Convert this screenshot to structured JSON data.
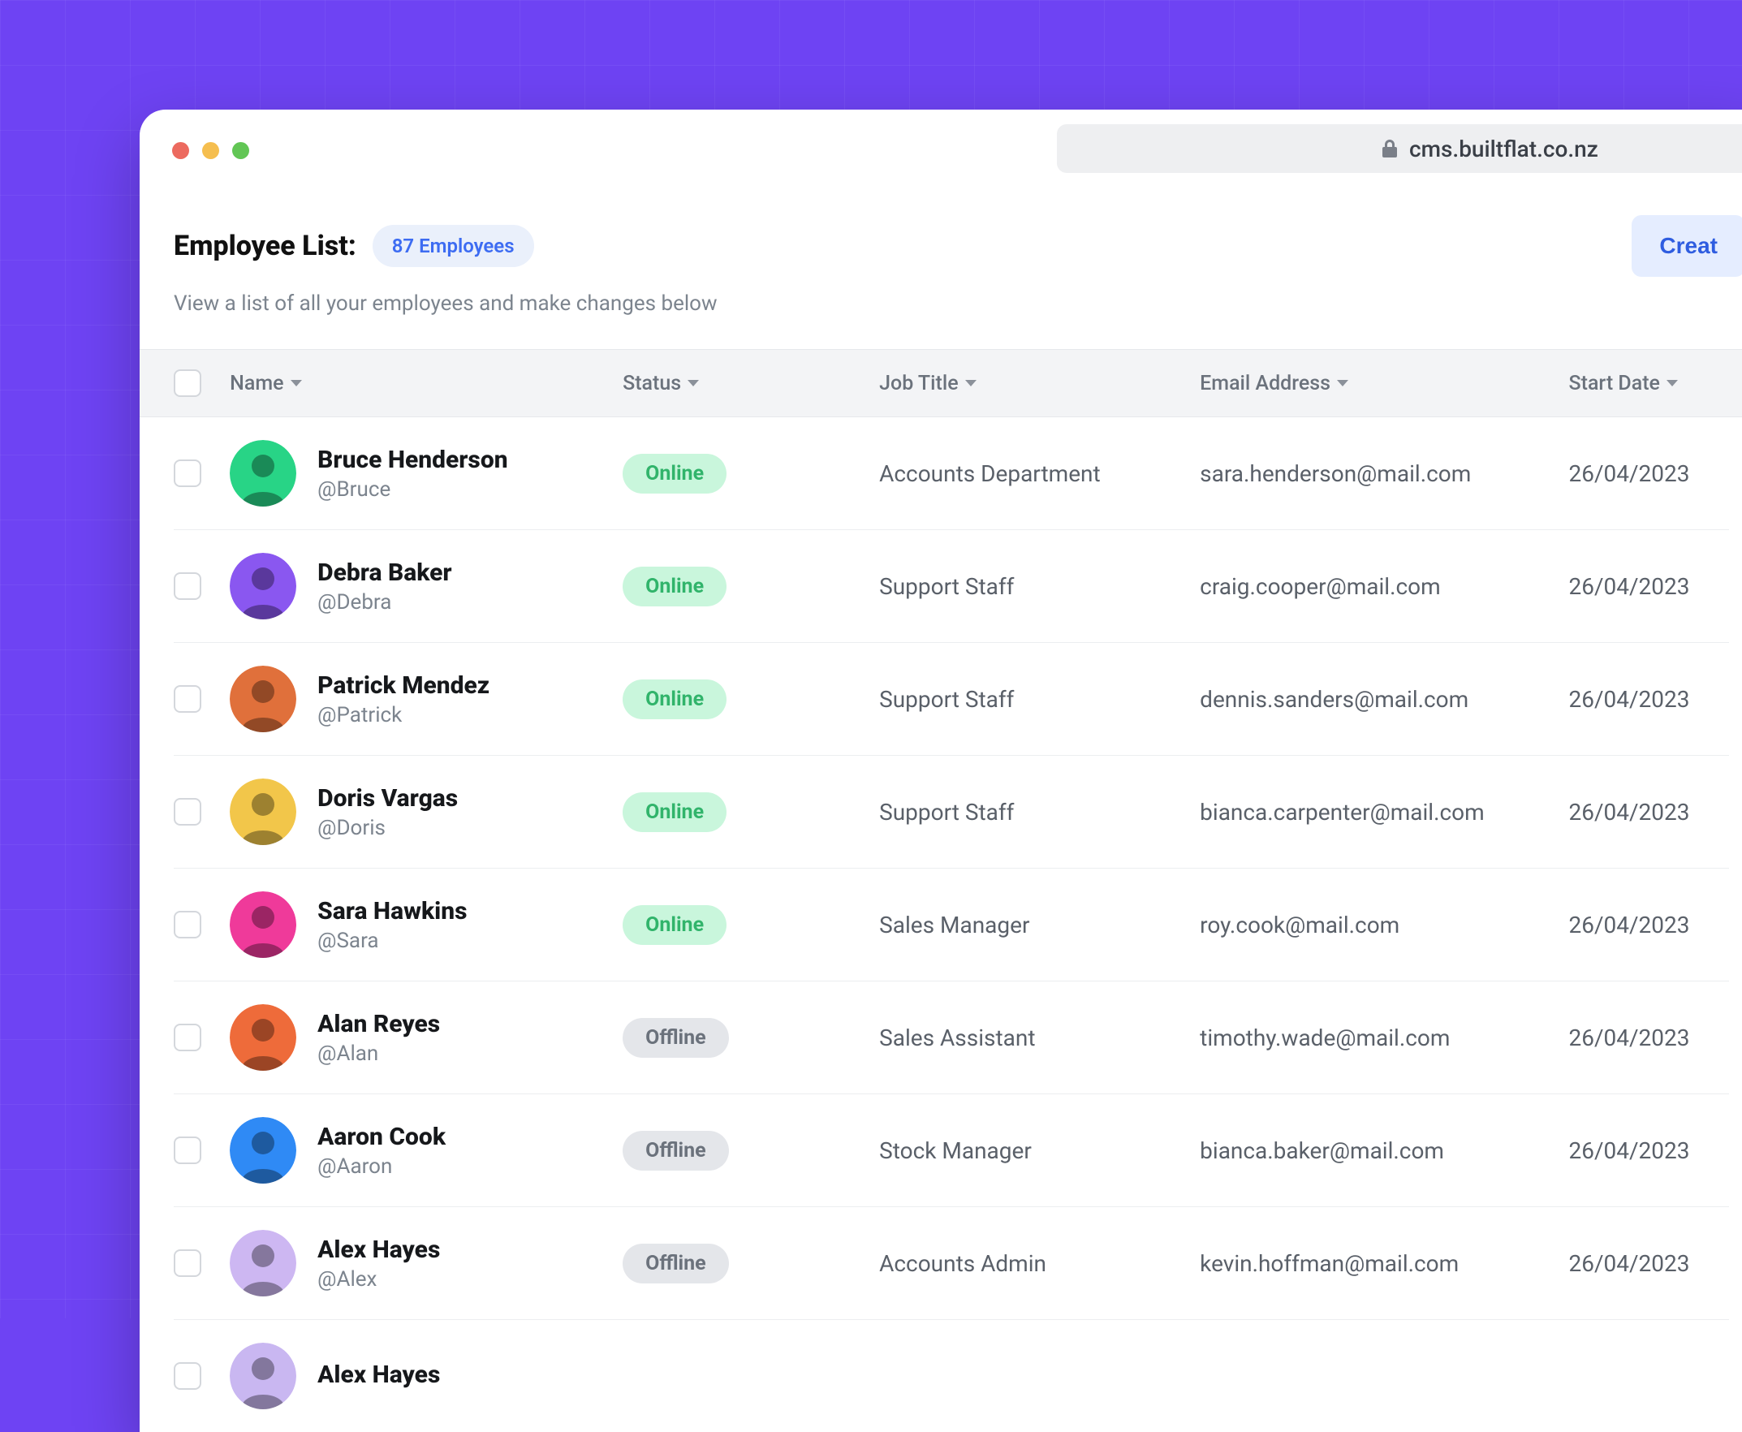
{
  "url": "cms.builtflat.co.nz",
  "header": {
    "title": "Employee List:",
    "count_badge": "87 Employees",
    "subtitle": "View a list of all your employees and make changes below",
    "create_button": "Creat"
  },
  "columns": {
    "name": "Name",
    "status": "Status",
    "job": "Job Title",
    "email": "Email Address",
    "start": "Start Date"
  },
  "status_labels": {
    "online": "Online",
    "offline": "Offline"
  },
  "avatar_colors": [
    "#28d486",
    "#8a57f0",
    "#e0703b",
    "#f2c64a",
    "#ef3a9a",
    "#ee6b3a",
    "#2f8af5",
    "#cdb7f2",
    "#c9b7f1"
  ],
  "employees": [
    {
      "name": "Bruce Henderson",
      "handle": "@Bruce",
      "status": "online",
      "job": "Accounts Department",
      "email": "sara.henderson@mail.com",
      "start": "26/04/2023"
    },
    {
      "name": "Debra Baker",
      "handle": "@Debra",
      "status": "online",
      "job": "Support Staff",
      "email": "craig.cooper@mail.com",
      "start": "26/04/2023"
    },
    {
      "name": "Patrick Mendez",
      "handle": "@Patrick",
      "status": "online",
      "job": "Support Staff",
      "email": "dennis.sanders@mail.com",
      "start": "26/04/2023"
    },
    {
      "name": "Doris Vargas",
      "handle": "@Doris",
      "status": "online",
      "job": "Support Staff",
      "email": "bianca.carpenter@mail.com",
      "start": "26/04/2023"
    },
    {
      "name": "Sara Hawkins",
      "handle": "@Sara",
      "status": "online",
      "job": "Sales Manager",
      "email": "roy.cook@mail.com",
      "start": "26/04/2023"
    },
    {
      "name": "Alan Reyes",
      "handle": "@Alan",
      "status": "offline",
      "job": "Sales Assistant",
      "email": "timothy.wade@mail.com",
      "start": "26/04/2023"
    },
    {
      "name": "Aaron Cook",
      "handle": "@Aaron",
      "status": "offline",
      "job": "Stock Manager",
      "email": "bianca.baker@mail.com",
      "start": "26/04/2023"
    },
    {
      "name": "Alex Hayes",
      "handle": "@Alex",
      "status": "offline",
      "job": "Accounts Admin",
      "email": "kevin.hoffman@mail.com",
      "start": "26/04/2023"
    },
    {
      "name": "Alex Hayes",
      "handle": "",
      "status": "",
      "job": "",
      "email": "",
      "start": ""
    }
  ]
}
